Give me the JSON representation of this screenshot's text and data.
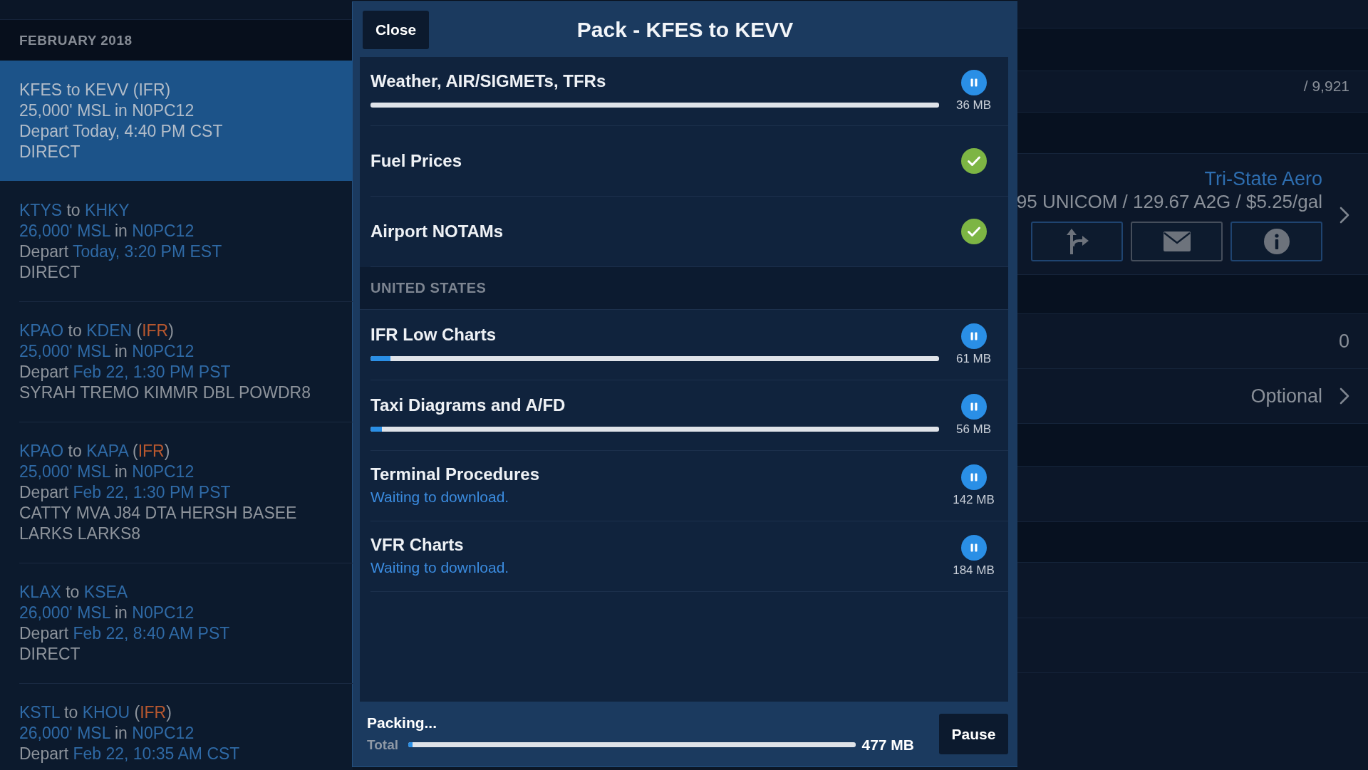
{
  "sidebar": {
    "month": "FEBRUARY 2018",
    "flights": [
      {
        "selected": true,
        "title": [
          {
            "text": "KFES to KEVV (IFR)",
            "kind": "plain"
          }
        ],
        "altitude": [
          {
            "text": "25,000' MSL in N0PC12",
            "kind": "plain"
          }
        ],
        "departure": [
          {
            "text": "Depart Today, 4:40 PM CST",
            "kind": "plain"
          }
        ],
        "route": "DIRECT"
      },
      {
        "selected": false,
        "title": [
          {
            "text": "KTYS",
            "kind": "accent"
          },
          {
            "text": " to ",
            "kind": "plain"
          },
          {
            "text": "KHKY",
            "kind": "accent"
          }
        ],
        "altitude": [
          {
            "text": "26,000' MSL",
            "kind": "accent"
          },
          {
            "text": " in ",
            "kind": "plain"
          },
          {
            "text": "N0PC12",
            "kind": "accent"
          }
        ],
        "departure": [
          {
            "text": "Depart ",
            "kind": "plain"
          },
          {
            "text": "Today, 3:20 PM EST",
            "kind": "accent"
          }
        ],
        "route": "DIRECT"
      },
      {
        "selected": false,
        "title": [
          {
            "text": "KPAO",
            "kind": "accent"
          },
          {
            "text": " to ",
            "kind": "plain"
          },
          {
            "text": "KDEN",
            "kind": "accent"
          },
          {
            "text": " (",
            "kind": "plain"
          },
          {
            "text": "IFR",
            "kind": "warning"
          },
          {
            "text": ")",
            "kind": "plain"
          }
        ],
        "altitude": [
          {
            "text": "25,000' MSL",
            "kind": "accent"
          },
          {
            "text": " in ",
            "kind": "plain"
          },
          {
            "text": "N0PC12",
            "kind": "accent"
          }
        ],
        "departure": [
          {
            "text": "Depart ",
            "kind": "plain"
          },
          {
            "text": "Feb 22, 1:30 PM PST",
            "kind": "accent"
          }
        ],
        "route": "SYRAH TREMO KIMMR DBL POWDR8"
      },
      {
        "selected": false,
        "title": [
          {
            "text": "KPAO",
            "kind": "accent"
          },
          {
            "text": " to ",
            "kind": "plain"
          },
          {
            "text": "KAPA",
            "kind": "accent"
          },
          {
            "text": " (",
            "kind": "plain"
          },
          {
            "text": "IFR",
            "kind": "warning"
          },
          {
            "text": ")",
            "kind": "plain"
          }
        ],
        "altitude": [
          {
            "text": "25,000' MSL",
            "kind": "accent"
          },
          {
            "text": " in ",
            "kind": "plain"
          },
          {
            "text": "N0PC12",
            "kind": "accent"
          }
        ],
        "departure": [
          {
            "text": "Depart ",
            "kind": "plain"
          },
          {
            "text": "Feb 22, 1:30 PM PST",
            "kind": "accent"
          }
        ],
        "route": "CATTY MVA J84 DTA HERSH BASEE LARKS LARKS8"
      },
      {
        "selected": false,
        "title": [
          {
            "text": "KLAX",
            "kind": "accent"
          },
          {
            "text": " to ",
            "kind": "plain"
          },
          {
            "text": "KSEA",
            "kind": "accent"
          }
        ],
        "altitude": [
          {
            "text": "26,000' MSL",
            "kind": "accent"
          },
          {
            "text": " in ",
            "kind": "plain"
          },
          {
            "text": "N0PC12",
            "kind": "accent"
          }
        ],
        "departure": [
          {
            "text": "Depart ",
            "kind": "plain"
          },
          {
            "text": "Feb 22, 8:40 AM PST",
            "kind": "accent"
          }
        ],
        "route": "DIRECT"
      },
      {
        "selected": false,
        "title": [
          {
            "text": "KSTL",
            "kind": "accent"
          },
          {
            "text": " to ",
            "kind": "plain"
          },
          {
            "text": "KHOU",
            "kind": "accent"
          },
          {
            "text": " (",
            "kind": "plain"
          },
          {
            "text": "IFR",
            "kind": "warning"
          },
          {
            "text": ")",
            "kind": "plain"
          }
        ],
        "altitude": [
          {
            "text": "26,000' MSL",
            "kind": "accent"
          },
          {
            "text": " in ",
            "kind": "plain"
          },
          {
            "text": "N0PC12",
            "kind": "accent"
          }
        ],
        "departure": [
          {
            "text": "Depart ",
            "kind": "plain"
          },
          {
            "text": "Feb 22, 10:35 AM CST",
            "kind": "accent"
          }
        ]
      }
    ]
  },
  "dialog": {
    "close_button": "Close",
    "title": "Pack - KFES to KEVV",
    "items": [
      {
        "kind": "item",
        "title": "Weather, AIR/SIGMETs, TFRs",
        "complete": false,
        "level": 0,
        "size": "36 MB"
      },
      {
        "kind": "item",
        "title": "Fuel Prices",
        "complete": true
      },
      {
        "kind": "item",
        "title": "Airport NOTAMs",
        "complete": true
      },
      {
        "kind": "section",
        "label": "UNITED STATES"
      },
      {
        "kind": "item",
        "title": "IFR Low Charts",
        "complete": false,
        "level": 0.035,
        "size": "61 MB"
      },
      {
        "kind": "item",
        "title": "Taxi Diagrams and A/FD",
        "complete": false,
        "level": 0.02,
        "size": "56 MB"
      },
      {
        "kind": "item",
        "title": "Terminal Procedures",
        "complete": false,
        "note": "Waiting to download.",
        "size": "142 MB"
      },
      {
        "kind": "item",
        "title": "VFR Charts",
        "complete": false,
        "note": "Waiting to download.",
        "size": "184 MB"
      }
    ],
    "footer": {
      "status": "Packing...",
      "total_label": "Total",
      "level": 0.01,
      "total_size": "477 MB",
      "pause_button": "Pause"
    }
  },
  "details_panel": {
    "weight_total": "/ 9,921",
    "fbo_name": "Tri-State Aero",
    "fbo_details": "95 UNICOM / 129.67 A2G / $5.25/gal",
    "count": "0",
    "optional": "Optional"
  }
}
